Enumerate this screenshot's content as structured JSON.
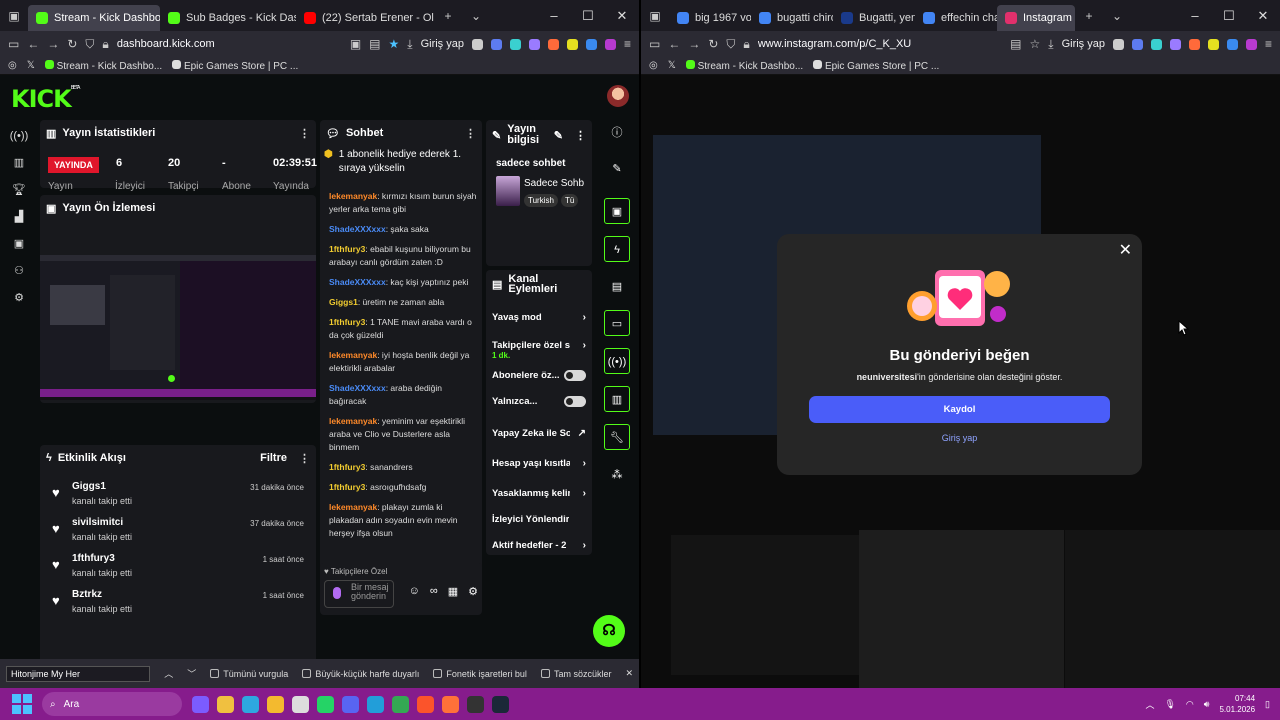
{
  "left": {
    "tabs": [
      {
        "label": "Stream - Kick Dashboard",
        "color": "#53fc18"
      },
      {
        "label": "Sub Badges - Kick Dashboa",
        "color": "#53fc18"
      },
      {
        "label": "(22) Sertab Erener - Ol",
        "color": "#ff0000"
      }
    ],
    "url": "dashboard.kick.com",
    "login": "Giriş yap",
    "bookmarks": [
      "Stream - Kick Dashbo...",
      "Epic Games Store | PC ..."
    ],
    "logo": "KICK",
    "beta": "BETA",
    "stats": {
      "title": "Yayın İstatistikleri",
      "live": "YAYINDA",
      "viewers": "6",
      "followers": "20",
      "subs": "-",
      "time": "02:39:51",
      "labels": [
        "Yayın",
        "İzleyici",
        "Takipçi",
        "Abone",
        "Yayında"
      ]
    },
    "preview": {
      "title": "Yayın Ön İzlemesi"
    },
    "activity": {
      "title": "Etkinlik Akışı",
      "filter": "Filtre",
      "items": [
        {
          "name": "Giggs1",
          "sub": "kanalı takip etti",
          "time": "31 dakika önce"
        },
        {
          "name": "sivilsimitci",
          "sub": "kanalı takip etti",
          "time": "37 dakika önce"
        },
        {
          "name": "1fthfury3",
          "sub": "kanalı takip etti",
          "time": "1 saat önce"
        },
        {
          "name": "Bztrkz",
          "sub": "kanalı takip etti",
          "time": "1 saat önce"
        }
      ]
    },
    "chat": {
      "title": "Sohbet",
      "pinned": "1 abonelik hediye ederek 1. sıraya yükselin",
      "messages": [
        {
          "user": "lekemanyak",
          "cls": "u1",
          "text": ": kırmızı kısım burun siyah yerler arka tema gibi"
        },
        {
          "user": "ShadeXXXxxx",
          "cls": "u2",
          "text": ": şaka saka"
        },
        {
          "user": "1fthfury3",
          "cls": "u3",
          "text": ": ebabil kuşunu biliyorum bu arabayı canlı gördüm zaten :D"
        },
        {
          "user": "ShadeXXXxxx",
          "cls": "u2",
          "text": ": kaç kişi yaptınız peki"
        },
        {
          "user": "Giggs1",
          "cls": "u3",
          "text": ": üretim ne zaman abla"
        },
        {
          "user": "1fthfury3",
          "cls": "u3",
          "text": ": 1 TANE mavi araba vardı o da çok güzeldi"
        },
        {
          "user": "lekemanyak",
          "cls": "u1",
          "text": ": iyi hoşta benlik değil ya elektirikli arabalar"
        },
        {
          "user": "ShadeXXXxxx",
          "cls": "u2",
          "text": ": araba dediğin bağıracak"
        },
        {
          "user": "lekemanyak",
          "cls": "u1",
          "text": ": yeminim var eşektirikli araba ve Clio ve Dusterlere asla binmem"
        },
        {
          "user": "1fthfury3",
          "cls": "u3",
          "text": ": sanandrers"
        },
        {
          "user": "1fthfury3",
          "cls": "u3",
          "text": ": asroıgufhdsafg"
        },
        {
          "user": "lekemanyak",
          "cls": "u1",
          "text": ": plakayı zumla ki plakadan adın soyadın evin mevin herşey ifşa olsun"
        }
      ],
      "follow_only": "Takipçilere Özel",
      "input_placeholder": "Bir mesaj gönderin"
    },
    "info": {
      "title": "Yayın bilgisi",
      "stream_title": "sadece sohbet",
      "category": "Sadece Sohb",
      "tags": [
        "Turkish",
        "Tü"
      ]
    },
    "actions": {
      "title": "Kanal Eylemleri",
      "items": [
        {
          "label": "Yavaş mod",
          "kind": "chev"
        },
        {
          "label": "Takipçilere özel s",
          "sub": "1 dk.",
          "kind": "chev"
        },
        {
          "label": "Abonelere öz...",
          "kind": "toggle"
        },
        {
          "label": "Yalnızca...",
          "kind": "toggle"
        },
        {
          "label": "Yapay Zeka ile Sohbet Denetimi",
          "kind": "ext"
        },
        {
          "label": "Hesap yaşı kısıtla",
          "kind": "chev"
        },
        {
          "label": "Yasaklanmış kelin",
          "kind": "chev"
        },
        {
          "label": "İzleyici Yönlendir",
          "kind": "none"
        },
        {
          "label": "Aktif hedefler - 2",
          "kind": "chev"
        }
      ]
    },
    "find": {
      "value": "Hitonjime My Her",
      "options": [
        "Tümünü vurgula",
        "Büyük-küçük harfe duyarlı",
        "Fonetik işaretleri bul",
        "Tam sözcükler"
      ]
    }
  },
  "right": {
    "tabs": [
      {
        "label": "big 1967 vosvo",
        "color": "#4285f4"
      },
      {
        "label": "bugatti chiron",
        "color": "#4285f4"
      },
      {
        "label": "Bugatti, yeni ik",
        "color": "#1a3a8a"
      },
      {
        "label": "effechin challe",
        "color": "#4285f4"
      },
      {
        "label": "Instagram",
        "color": "#e1306c"
      }
    ],
    "url": "www.instagram.com/p/C_K_XU",
    "login": "Giriş yap",
    "bookmarks": [
      "Stream - Kick Dashbo...",
      "Epic Games Store | PC ..."
    ],
    "modal": {
      "title": "Bu gönderiyi beğen",
      "account": "neuniversitesi",
      "subtitle": "'in gönderisine olan desteğini göster.",
      "button": "Kaydol",
      "link": "Giriş yap"
    }
  },
  "taskbar": {
    "search": "Ara",
    "time": "07:44",
    "date": "5.01.2026"
  }
}
